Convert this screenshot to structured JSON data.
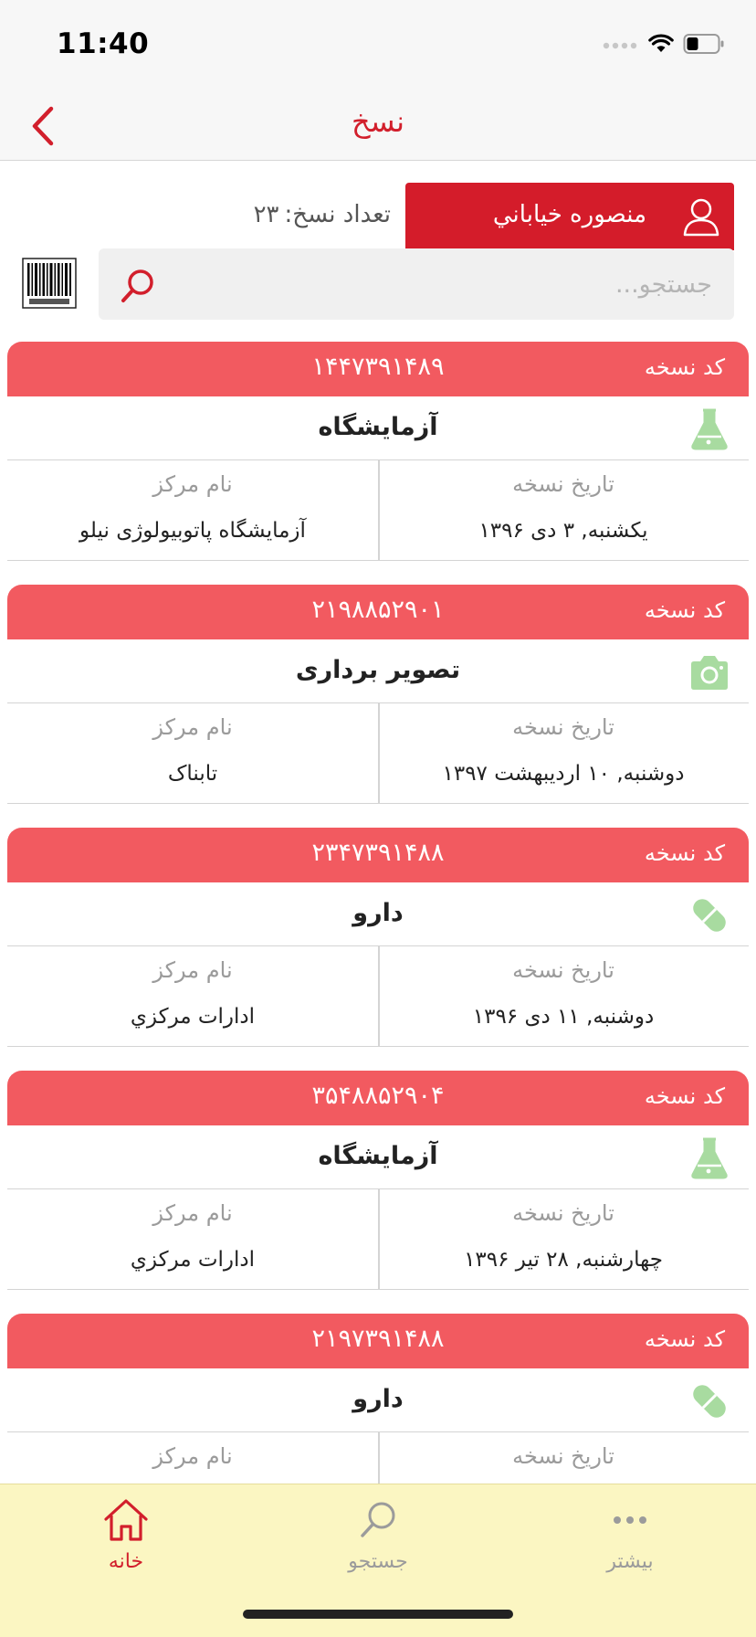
{
  "status_bar": {
    "time": "11:40"
  },
  "nav": {
    "title": "نسخ"
  },
  "user": {
    "name": "منصوره خياباني"
  },
  "prescriptions": {
    "count_label": "تعداد نسخ:",
    "count_value": "۲۳"
  },
  "search": {
    "placeholder": "جستجو..."
  },
  "card_labels": {
    "code": "کد نسخه",
    "date": "تاریخ نسخه",
    "center": "نام مرکز"
  },
  "cards": [
    {
      "code": "۱۴۴۷۳۹۱۴۸۹",
      "type": "آزمایشگاه",
      "icon": "flask-icon",
      "date": "یکشنبه, ۳ دی ۱۳۹۶",
      "center": "آزمایشگاه پاتوبیولوژی نیلو"
    },
    {
      "code": "۲۱۹۸۸۵۲۹۰۱",
      "type": "تصویر برداری",
      "icon": "camera-icon",
      "date": "دوشنبه, ۱۰ اردیبهشت ۱۳۹۷",
      "center": "تابناک"
    },
    {
      "code": "۲۳۴۷۳۹۱۴۸۸",
      "type": "دارو",
      "icon": "pill-icon",
      "date": "دوشنبه, ۱۱ دی ۱۳۹۶",
      "center": "ادارات مرکزي"
    },
    {
      "code": "۳۵۴۸۸۵۲۹۰۴",
      "type": "آزمایشگاه",
      "icon": "flask-icon",
      "date": "چهارشنبه, ۲۸ تیر ۱۳۹۶",
      "center": "ادارات مرکزي"
    },
    {
      "code": "۲۱۹۷۳۹۱۴۸۸",
      "type": "دارو",
      "icon": "pill-icon",
      "date": "",
      "center": ""
    }
  ],
  "tabs": [
    {
      "label": "خانه",
      "icon": "home-icon",
      "active": true
    },
    {
      "label": "جستجو",
      "icon": "search-icon",
      "active": false
    },
    {
      "label": "بیشتر",
      "icon": "more-icon",
      "active": false
    }
  ],
  "colors": {
    "accent": "#d21f2c",
    "card_header": "#f25a60",
    "type_icon": "#a8dba0",
    "tab_bar": "#fbf6c2"
  }
}
